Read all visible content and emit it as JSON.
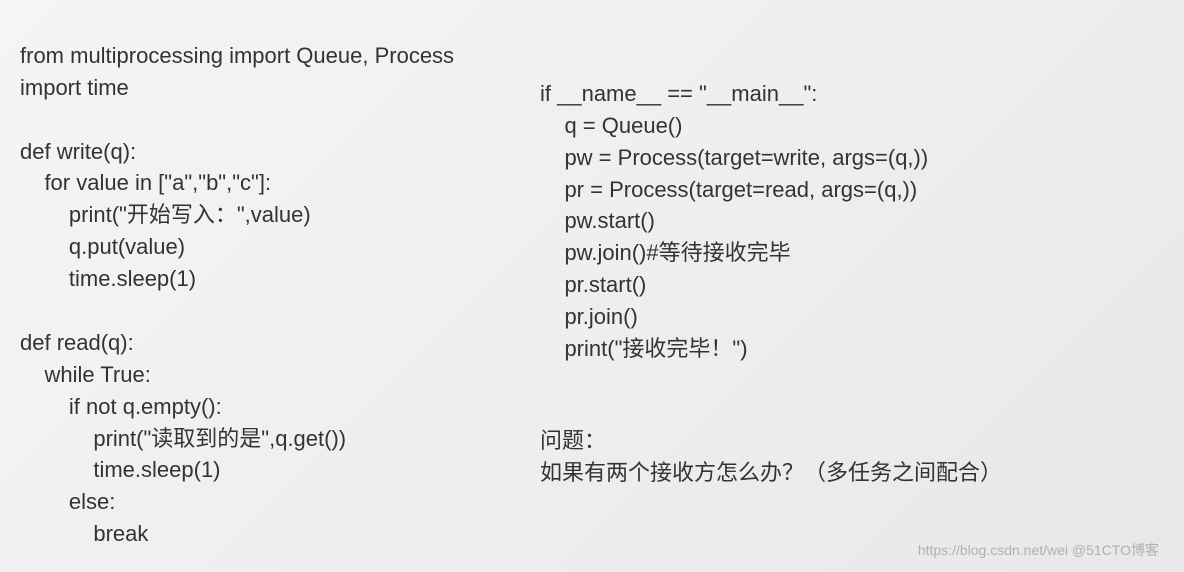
{
  "left_code": {
    "l01": "from multiprocessing import Queue, Process",
    "l02": "import time",
    "l03": "",
    "l04": "def write(q):",
    "l05": "    for value in [\"a\",\"b\",\"c\"]:",
    "l06": "        print(\"开始写入：\",value)",
    "l07": "        q.put(value)",
    "l08": "        time.sleep(1)",
    "l09": "",
    "l10": "def read(q):",
    "l11": "    while True:",
    "l12": "        if not q.empty():",
    "l13": "            print(\"读取到的是\",q.get())",
    "l14": "            time.sleep(1)",
    "l15": "        else:",
    "l16": "            break"
  },
  "right_code": {
    "r01": "if __name__ == \"__main__\":",
    "r02": "    q = Queue()",
    "r03": "    pw = Process(target=write, args=(q,))",
    "r04": "    pr = Process(target=read, args=(q,))",
    "r05": "    pw.start()",
    "r06": "    pw.join()#等待接收完毕",
    "r07": "    pr.start()",
    "r08": "    pr.join()",
    "r09": "    print(\"接收完毕！\")"
  },
  "question": {
    "title": "问题：",
    "body": "如果有两个接收方怎么办？（多任务之间配合）"
  },
  "watermark": "https://blog.csdn.net/wei @51CTO博客"
}
